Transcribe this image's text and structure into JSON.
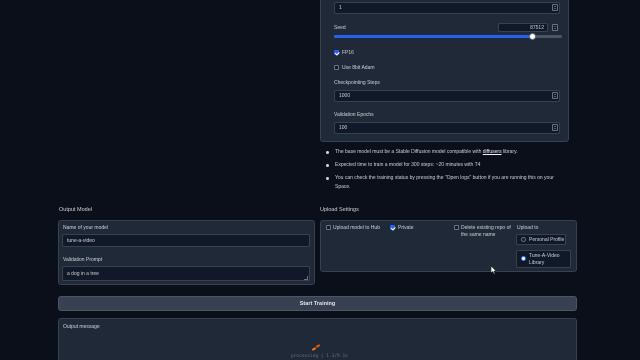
{
  "training": {
    "top_input_value": "1",
    "seed_label": "Seed",
    "seed_value": "87512",
    "seed_fraction": 0.87,
    "fp16_label": "FP16",
    "fp16_checked": true,
    "adam_label": "Use 8bit Adam",
    "adam_checked": false,
    "checkpointing_label": "Checkpointing Steps",
    "checkpointing_value": "1000",
    "validation_epochs_label": "Validation Epochs",
    "validation_epochs_value": "100"
  },
  "info": {
    "line1_prefix": "The base model must be a Stable Diffusion model compatible with ",
    "line1_link": "diffusers",
    "line1_suffix": " library.",
    "line2": "Expected time to train a model for 300 steps: ~20 minutes with T4",
    "line3a": "You can check the training status by pressing the \"Open logs\" button if you are running this on your",
    "line3b": "Space."
  },
  "output_model": {
    "section_title": "Output Model",
    "name_label": "Name of your model",
    "name_value": "tune-a-video",
    "prompt_label": "Validation Prompt",
    "prompt_value": "a dog in a tree"
  },
  "upload": {
    "section_title": "Upload Settings",
    "upload_to_hub_label": "Upload model to Hub",
    "private_label": "Private",
    "delete_repo_label_1": "Delete existing repo of",
    "delete_repo_label_2": "the same name",
    "upload_to_label": "Upload to",
    "option_personal": "Personal Profile",
    "option_library_1": "Tune-A-Video",
    "option_library_2": "Library"
  },
  "actions": {
    "start_training": "Start Training"
  },
  "output": {
    "label": "Output message",
    "status": "processing | 1.3/9.1s"
  },
  "colors": {
    "accent": "#2563eb",
    "background": "#0b0f19",
    "panel": "#1f2937",
    "loader": "#f97316"
  }
}
